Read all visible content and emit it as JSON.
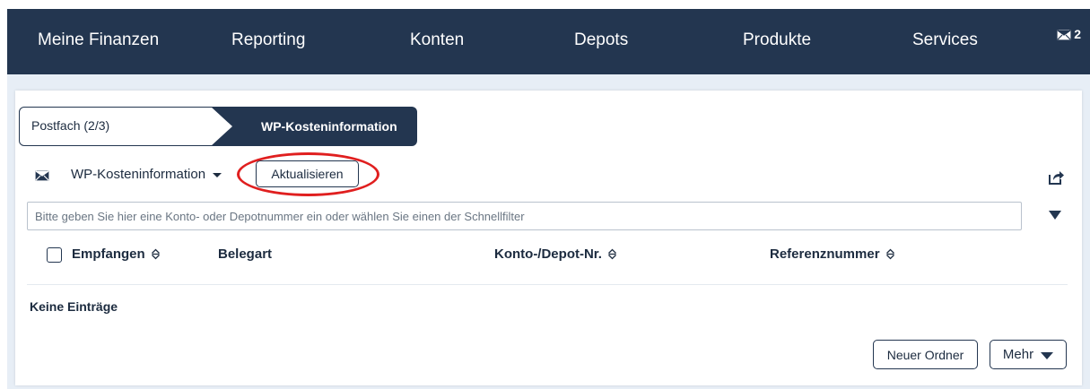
{
  "nav": {
    "items": [
      "Meine Finanzen",
      "Reporting",
      "Konten",
      "Depots",
      "Produkte",
      "Services"
    ],
    "mail_icon": "envelope-icon",
    "mail_count": "2",
    "background": "#233650"
  },
  "breadcrumb": {
    "first": "Postfach (2/3)",
    "current": "WP-Kosteninformation"
  },
  "toolbar": {
    "mail_icon": "envelope-icon",
    "folder_label": "WP-Kosteninformation",
    "refresh_label": "Aktualisieren",
    "share_icon": "share-icon",
    "highlight_color": "#e01f1f"
  },
  "filter": {
    "placeholder": "Bitte geben Sie hier eine Konto- oder Depotnummer ein oder wählen Sie einen der Schnellfilter",
    "value": ""
  },
  "table": {
    "columns": [
      "Empfangen",
      "Belegart",
      "Konto-/Depot-Nr.",
      "Referenznummer"
    ],
    "empty_text": "Keine Einträge"
  },
  "actions": {
    "new_folder": "Neuer Ordner",
    "more": "Mehr"
  }
}
